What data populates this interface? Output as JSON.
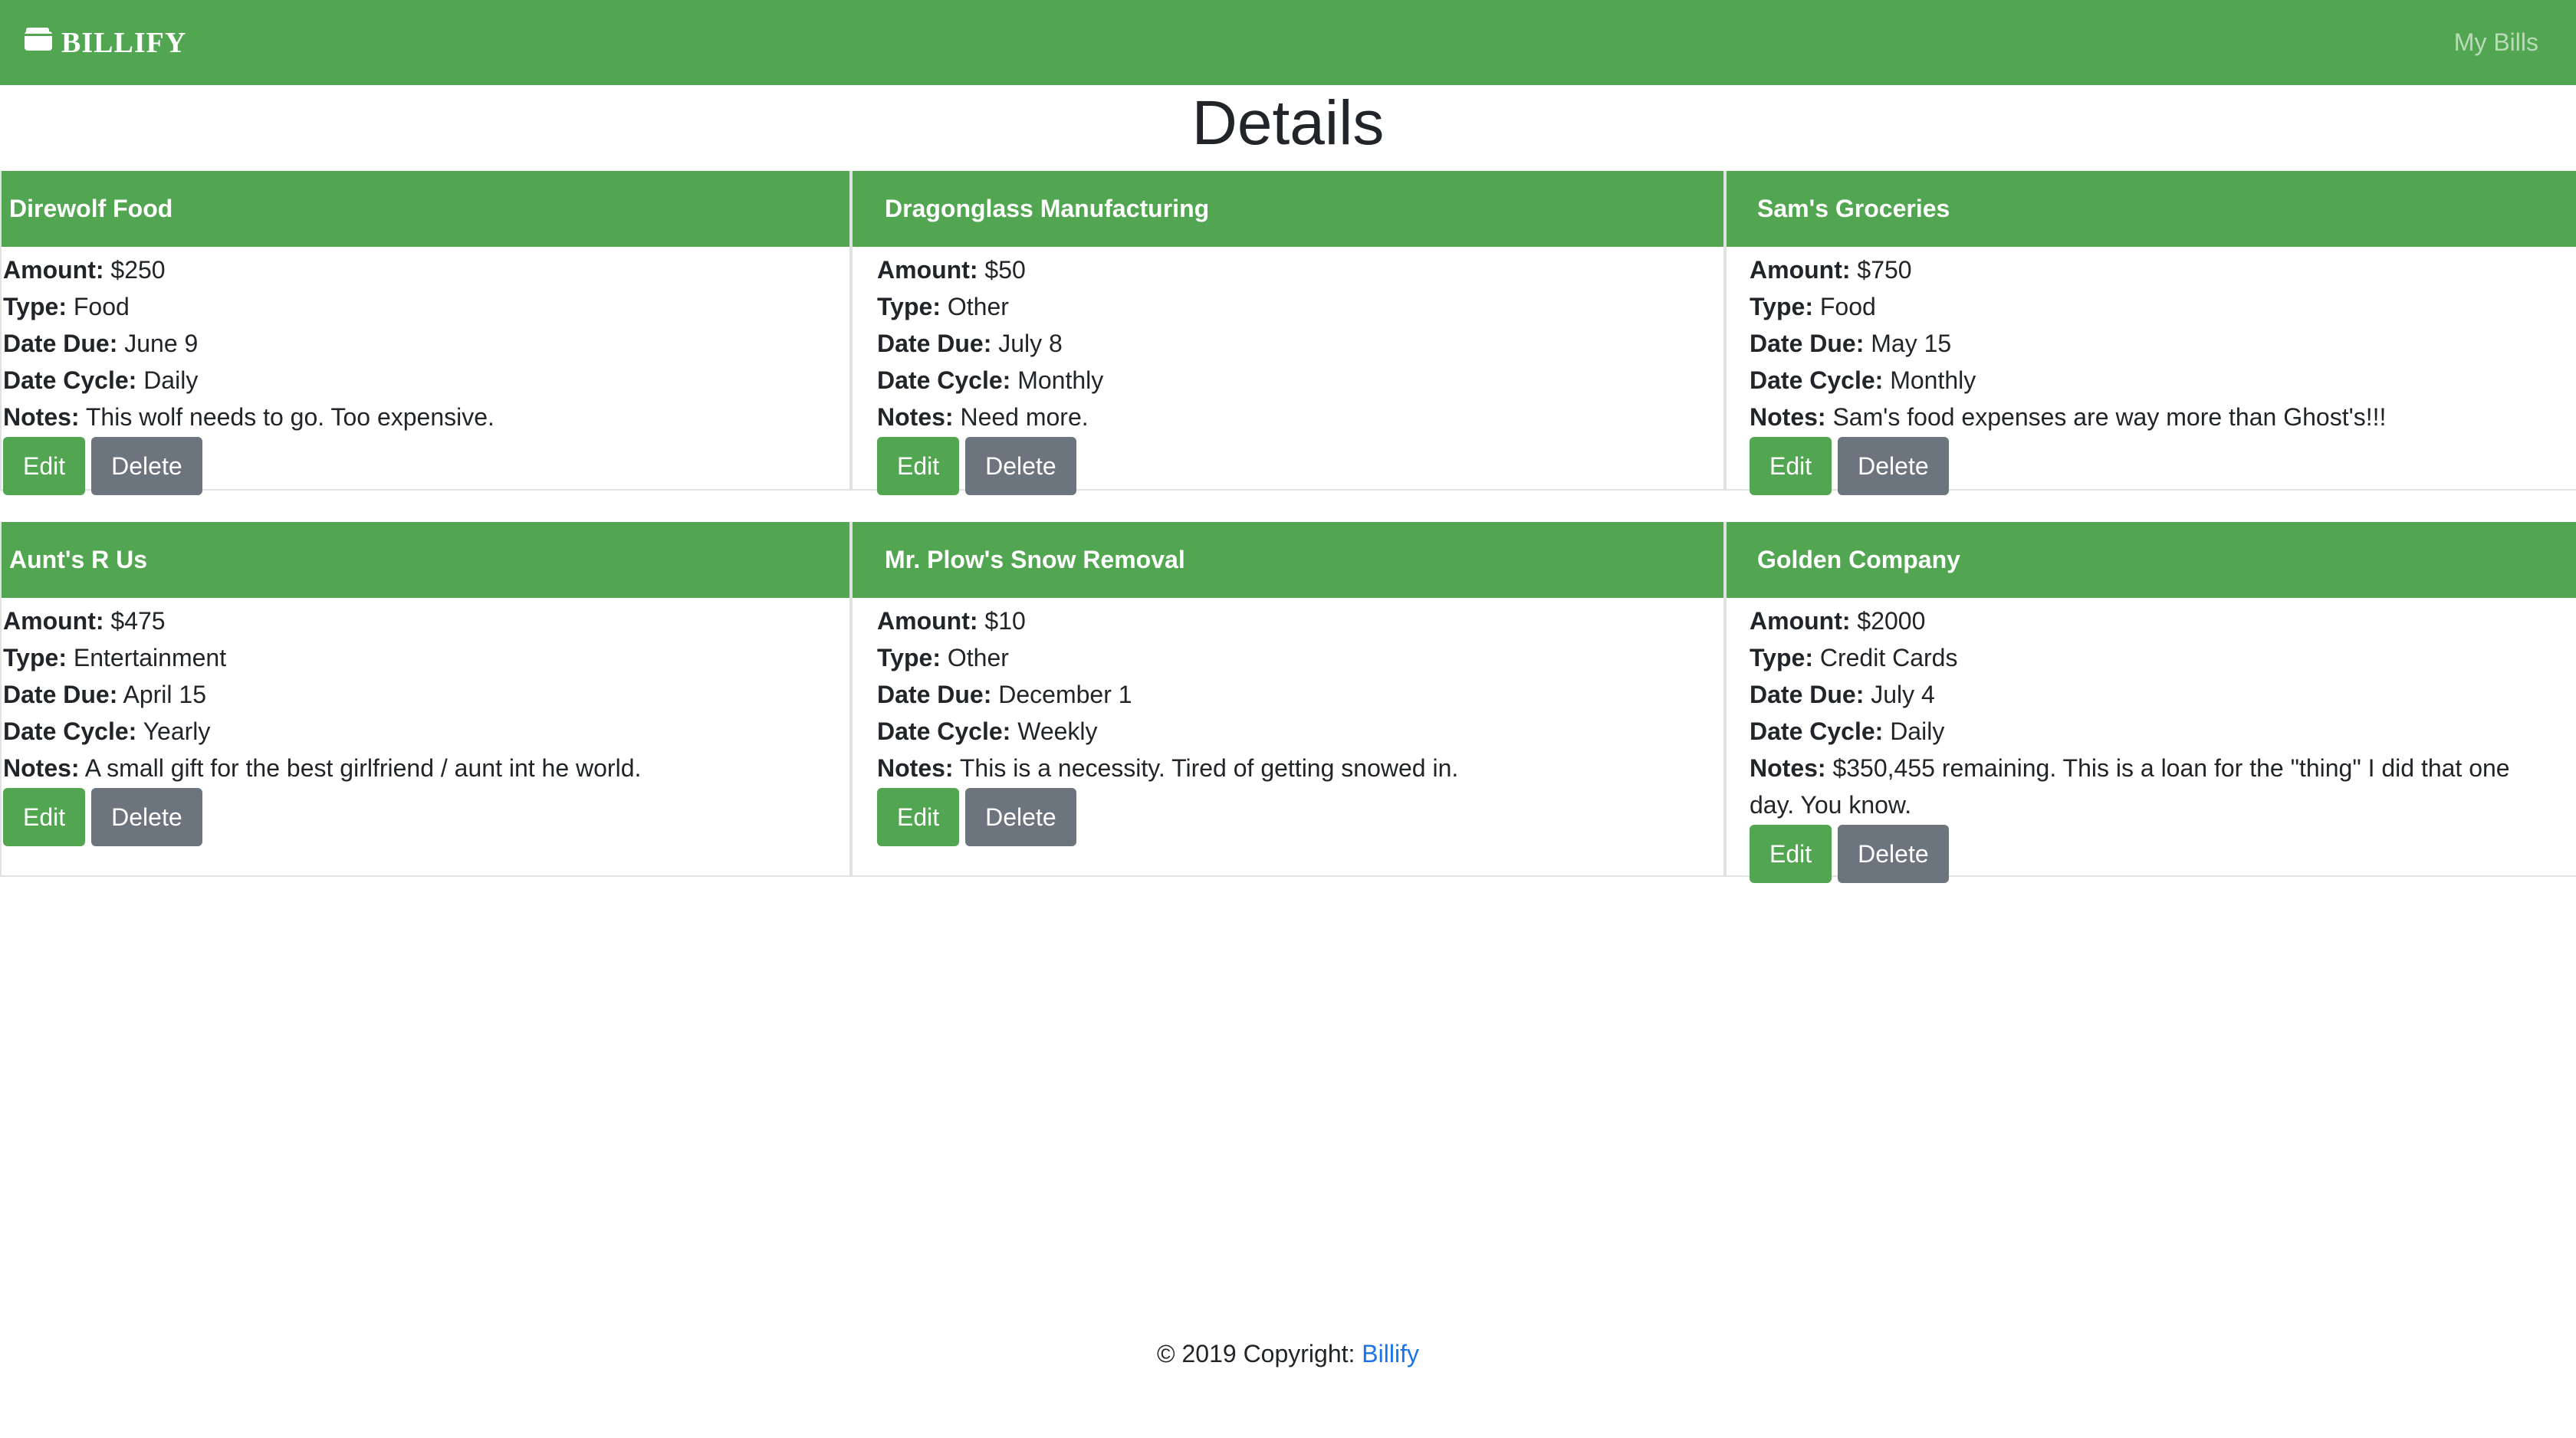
{
  "navbar": {
    "brand": "BILLIFY",
    "brand_icon": "wallet-icon",
    "link": "My Bills"
  },
  "page": {
    "title": "Details"
  },
  "labels": {
    "amount": "Amount:",
    "type": "Type:",
    "date_due": "Date Due:",
    "date_cycle": "Date Cycle:",
    "notes": "Notes:",
    "edit": "Edit",
    "delete": "Delete"
  },
  "bills": [
    {
      "name": "Direwolf Food",
      "amount": "$250",
      "type": "Food",
      "date_due": "June 9",
      "date_cycle": "Daily",
      "notes": "This wolf needs to go. Too expensive."
    },
    {
      "name": "Dragonglass Manufacturing",
      "amount": "$50",
      "type": "Other",
      "date_due": "July 8",
      "date_cycle": "Monthly",
      "notes": "Need more."
    },
    {
      "name": "Sam's Groceries",
      "amount": "$750",
      "type": "Food",
      "date_due": "May 15",
      "date_cycle": "Monthly",
      "notes": "Sam's food expenses are way more than Ghost's!!!"
    },
    {
      "name": "Aunt's R Us",
      "amount": "$475",
      "type": "Entertainment",
      "date_due": "April 15",
      "date_cycle": "Yearly",
      "notes": "A small gift for the best girlfriend / aunt int he world."
    },
    {
      "name": "Mr. Plow's Snow Removal",
      "amount": "$10",
      "type": "Other",
      "date_due": "December 1",
      "date_cycle": "Weekly",
      "notes": "This is a necessity. Tired of getting snowed in."
    },
    {
      "name": "Golden Company",
      "amount": "$2000",
      "type": "Credit Cards",
      "date_due": "July 4",
      "date_cycle": "Daily",
      "notes": "$350,455 remaining. This is a loan for the \"thing\" I did that one day. You know."
    }
  ],
  "footer": {
    "text": "© 2019 Copyright: ",
    "link": "Billify"
  },
  "colors": {
    "primary": "#53a651",
    "secondary": "#6c757d",
    "link": "#1a73e8"
  }
}
